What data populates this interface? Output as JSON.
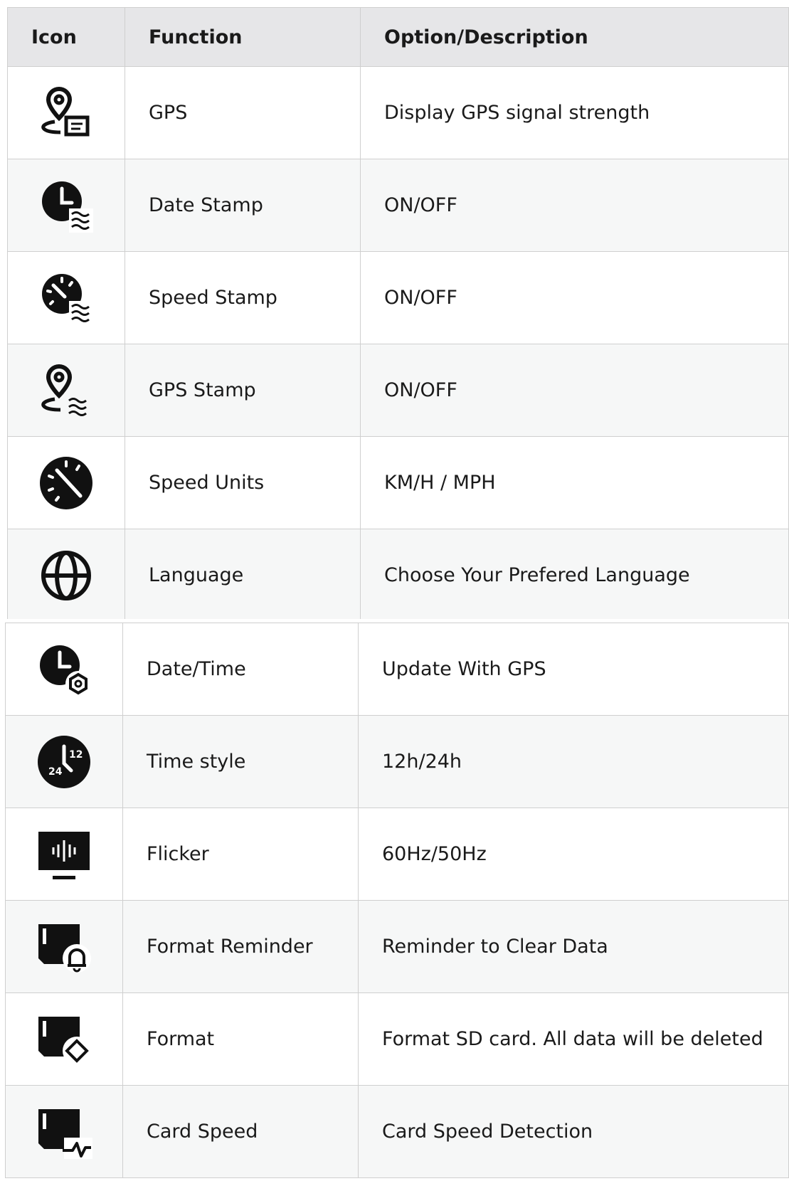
{
  "header": {
    "icon": "Icon",
    "function": "Function",
    "description": "Option/Description"
  },
  "rows": [
    {
      "icon": "gps-location-icon",
      "function": "GPS",
      "description": "Display GPS signal strength"
    },
    {
      "icon": "date-stamp-icon",
      "function": "Date Stamp",
      "description": "ON/OFF"
    },
    {
      "icon": "speed-stamp-icon",
      "function": "Speed Stamp",
      "description": "ON/OFF"
    },
    {
      "icon": "gps-stamp-icon",
      "function": "GPS Stamp",
      "description": "ON/OFF"
    },
    {
      "icon": "speedometer-icon",
      "function": "Speed Units",
      "description": "KM/H / MPH"
    },
    {
      "icon": "globe-icon",
      "function": "Language",
      "description": "Choose Your Prefered Language"
    },
    {
      "icon": "clock-settings-icon",
      "function": "Date/Time",
      "description": "Update With GPS"
    },
    {
      "icon": "clock-12-24-icon",
      "function": "Time style",
      "description": "12h/24h",
      "icon_labels": [
        "24",
        "12"
      ]
    },
    {
      "icon": "flicker-monitor-icon",
      "function": "Flicker",
      "description": "60Hz/50Hz"
    },
    {
      "icon": "sd-card-bell-icon",
      "function": "Format Reminder",
      "description": "Reminder to Clear Data"
    },
    {
      "icon": "sd-card-eraser-icon",
      "function": "Format",
      "description": "Format SD card. All data will be deleted"
    },
    {
      "icon": "sd-card-speed-icon",
      "function": "Card Speed",
      "description": "Card Speed Detection"
    }
  ]
}
